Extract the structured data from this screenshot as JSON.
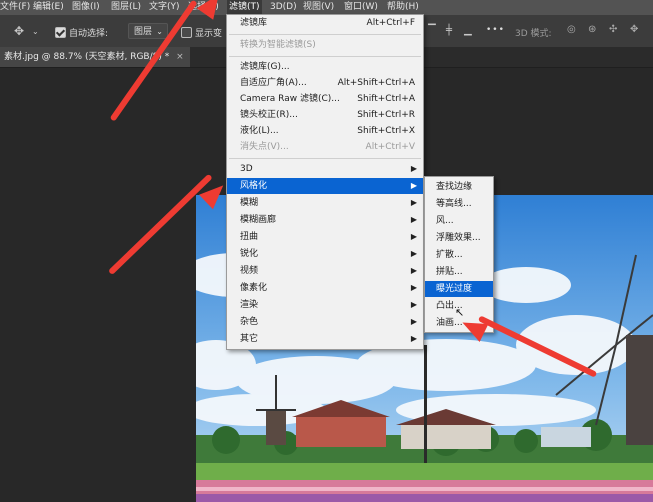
{
  "menubar": {
    "items": [
      {
        "label": "文件(F)"
      },
      {
        "label": "编辑(E)"
      },
      {
        "label": "图像(I)"
      },
      {
        "label": "图层(L)"
      },
      {
        "label": "文字(Y)"
      },
      {
        "label": "选择(S)"
      },
      {
        "label": "滤镜(T)"
      },
      {
        "label": "3D(D)"
      },
      {
        "label": "视图(V)"
      },
      {
        "label": "窗口(W)"
      },
      {
        "label": "帮助(H)"
      }
    ]
  },
  "options_bar": {
    "auto_select_label": "自动选择:",
    "auto_select_checked": true,
    "layer_dropdown": "图层",
    "show_transform_label": "显示变",
    "mode_3d_label": "3D 模式:",
    "more_label": "•••"
  },
  "document_tab": {
    "title": "素材.jpg @ 88.7% (天空素材, RGB/8) *",
    "close": "×"
  },
  "filter_menu": {
    "items": [
      {
        "label": "滤镜库",
        "shortcut": "Alt+Ctrl+F",
        "disabled": false
      },
      {
        "label": "转换为智能滤镜(S)",
        "shortcut": "",
        "disabled": true
      },
      {
        "label": "滤镜库(G)...",
        "shortcut": "",
        "disabled": false
      },
      {
        "label": "自适应广角(A)...",
        "shortcut": "Alt+Shift+Ctrl+A",
        "disabled": false
      },
      {
        "label": "Camera Raw 滤镜(C)...",
        "shortcut": "Shift+Ctrl+A",
        "disabled": false
      },
      {
        "label": "镜头校正(R)...",
        "shortcut": "Shift+Ctrl+R",
        "disabled": false
      },
      {
        "label": "液化(L)...",
        "shortcut": "Shift+Ctrl+X",
        "disabled": false
      },
      {
        "label": "消失点(V)...",
        "shortcut": "Alt+Ctrl+V",
        "disabled": true
      },
      {
        "label": "3D",
        "submenu": true
      },
      {
        "label": "风格化",
        "submenu": true,
        "highlighted": true
      },
      {
        "label": "模糊",
        "submenu": true
      },
      {
        "label": "模糊画廊",
        "submenu": true
      },
      {
        "label": "扭曲",
        "submenu": true
      },
      {
        "label": "锐化",
        "submenu": true
      },
      {
        "label": "视频",
        "submenu": true
      },
      {
        "label": "像素化",
        "submenu": true
      },
      {
        "label": "渲染",
        "submenu": true
      },
      {
        "label": "杂色",
        "submenu": true
      },
      {
        "label": "其它",
        "submenu": true
      }
    ]
  },
  "stylize_submenu": {
    "items": [
      {
        "label": "查找边缘"
      },
      {
        "label": "等高线..."
      },
      {
        "label": "风..."
      },
      {
        "label": "浮雕效果..."
      },
      {
        "label": "扩散..."
      },
      {
        "label": "拼贴..."
      },
      {
        "label": "曝光过度",
        "highlighted": true
      },
      {
        "label": "凸出..."
      },
      {
        "label": "油画..."
      }
    ]
  },
  "colors": {
    "menu_highlight": "#0a64d2",
    "annotation_arrow": "#ee3b32"
  }
}
